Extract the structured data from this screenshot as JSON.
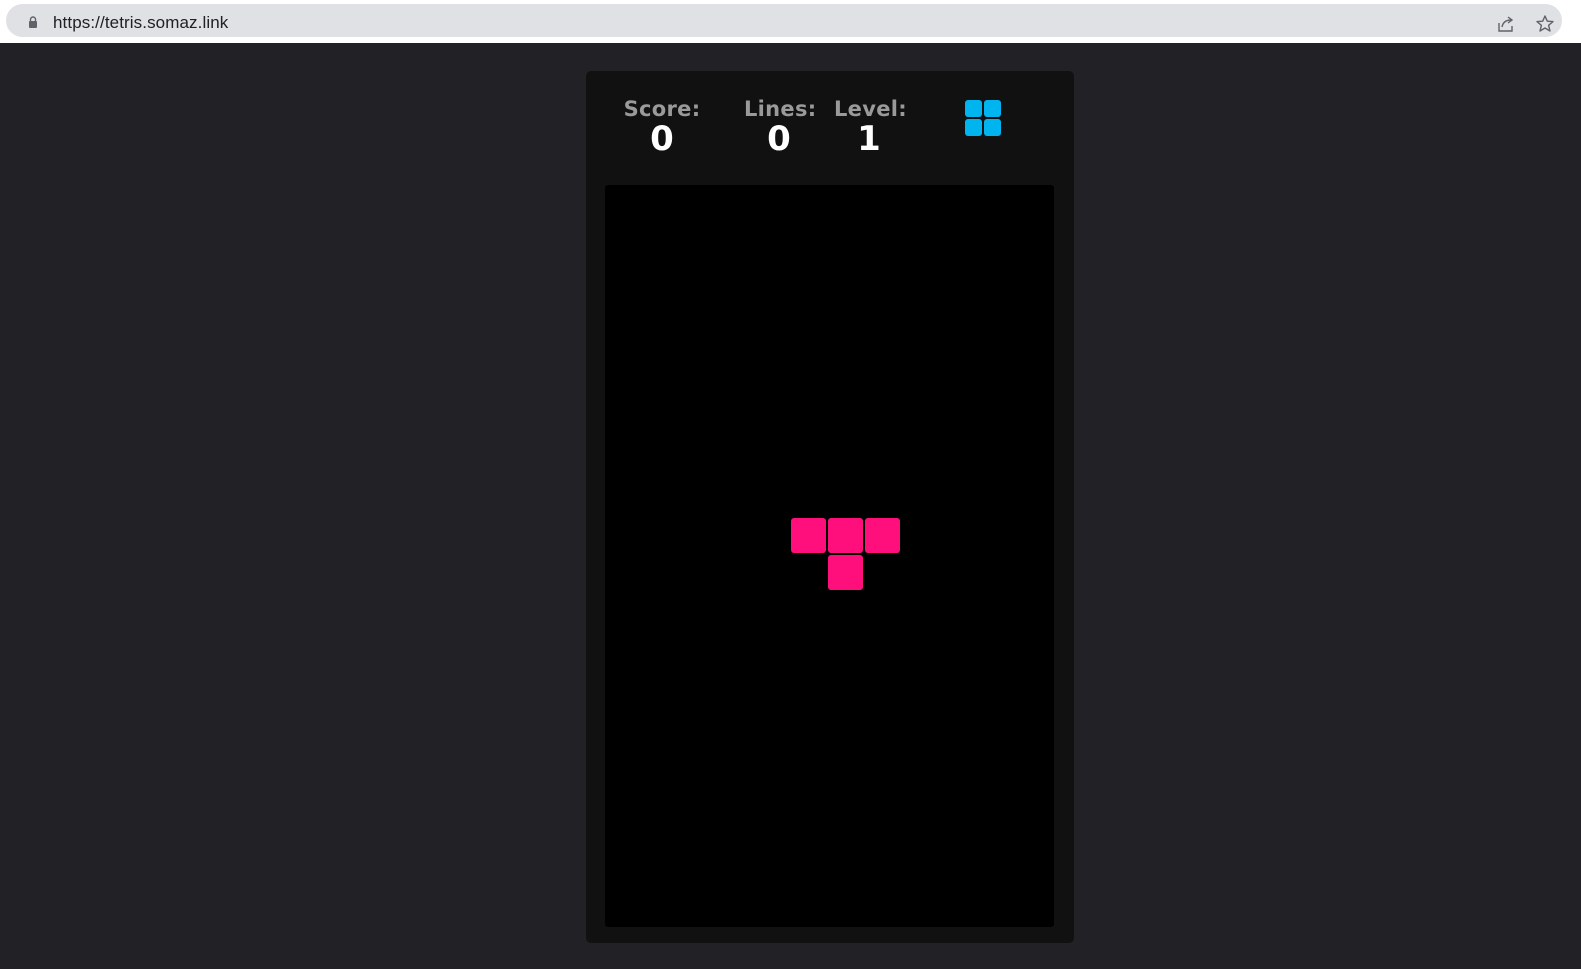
{
  "browser": {
    "url": "https://tetris.somaz.link",
    "icons": [
      "lock-icon",
      "share-icon",
      "star-icon"
    ]
  },
  "game": {
    "score_label": "Score:",
    "score_value": "0",
    "lines_label": "Lines:",
    "lines_value": "0",
    "level_label": "Level:",
    "level_value": "1",
    "next_piece": {
      "shape": "O",
      "color": "#00b4f0"
    },
    "active_piece": {
      "shape": "T",
      "color": "#ff0f7b"
    }
  },
  "colors": {
    "page_background": "#212126",
    "panel_background": "#111111",
    "board_background": "#000000",
    "label_text": "#9a9a9a",
    "value_text": "#ffffff"
  }
}
